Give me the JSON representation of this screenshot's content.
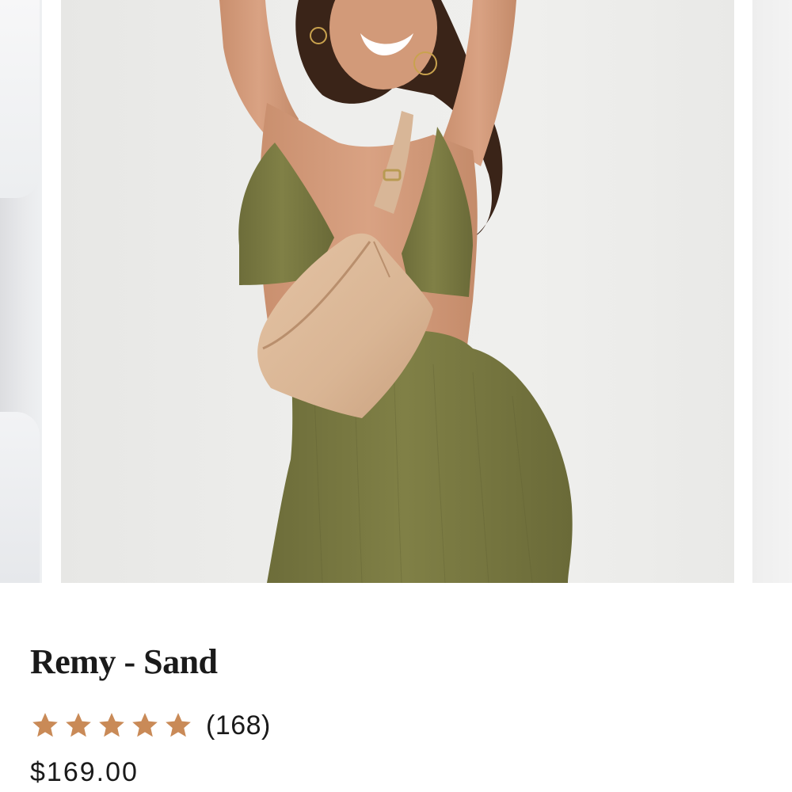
{
  "product": {
    "name": "Remy - Sand",
    "rating": 5,
    "rating_max": 5,
    "review_count": "(168)",
    "price": "$169.00"
  },
  "carousel": {
    "main_image_alt": "Model wearing sand leather fanny pack across chest"
  },
  "colors": {
    "star": "#c98a57",
    "text": "#1a1a1a",
    "bag": "#d9b594",
    "dress": "#7b7b45"
  }
}
